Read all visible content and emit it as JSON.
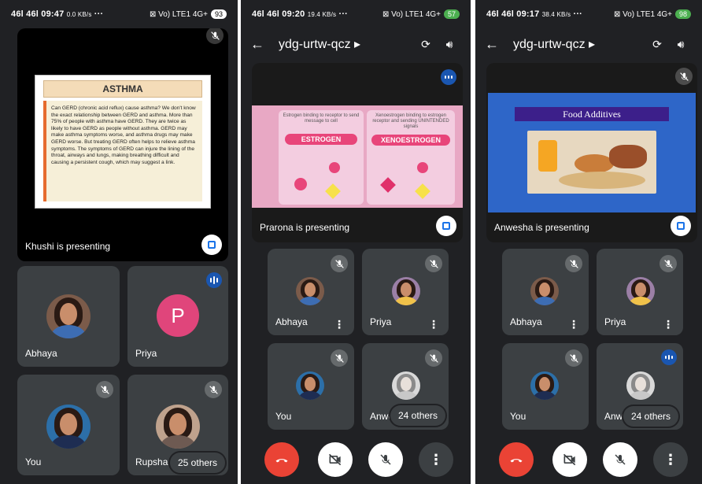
{
  "phone1": {
    "status": {
      "time": "46l 46l 09:47",
      "net": "0.0 KB/s",
      "right": "⊠ Vo) LTE1 4G+",
      "battery": "93"
    },
    "slide_title": "ASTHMA",
    "slide_text": "Can GERD (chronic acid reflux) cause asthma? We don't know the exact relationship between GERD and asthma. More than 75% of people with asthma have GERD. They are twice as likely to have GERD as people without asthma. GERD may make asthma symptoms worse, and asthma drugs may make GERD worse. But treating GERD often helps to relieve asthma symptoms. The symptoms of GERD can injure the lining of the throat, airways and lungs, making breathing difficult and causing a persistent cough, which may suggest a link.",
    "presenting": "Khushi is presenting",
    "tiles": [
      {
        "name": "Abhaya"
      },
      {
        "name": "Priya",
        "initial": "P"
      },
      {
        "name": "You"
      },
      {
        "name": "Rupsha"
      }
    ],
    "others": "25 others"
  },
  "phone2": {
    "status": {
      "time": "46l 46l 09:20",
      "net": "19.4 KB/s",
      "right": "⊠ Vo) LTE1 4G+",
      "battery": "57"
    },
    "meeting_code": "ydg-urtw-qcz",
    "slide_left": "Estrogen binding to receptor to send message to cell",
    "slide_right": "Xenoestrogen binding to estrogen receptor and sending UNINTENDED signals",
    "label_estrogen": "ESTROGEN",
    "label_xeno": "XENOESTROGEN",
    "presenting": "Prarona is presenting",
    "tiles": [
      {
        "name": "Abhaya"
      },
      {
        "name": "Priya"
      },
      {
        "name": "You"
      },
      {
        "name": "Anwe"
      }
    ],
    "others": "24 others"
  },
  "phone3": {
    "status": {
      "time": "46l 46l 09:17",
      "net": "38.4 KB/s",
      "right": "⊠ Vo) LTE1 4G+",
      "battery": "98"
    },
    "meeting_code": "ydg-urtw-qcz",
    "slide_title": "Food Additives",
    "presenting": "Anwesha is presenting",
    "tiles": [
      {
        "name": "Abhaya"
      },
      {
        "name": "Priya"
      },
      {
        "name": "You"
      },
      {
        "name": "Anwe"
      }
    ],
    "others": "24 others"
  },
  "colors": {
    "bg": "#202124",
    "tile": "#3c4043",
    "end_call": "#ea4335",
    "accent": "#1a73e8"
  }
}
